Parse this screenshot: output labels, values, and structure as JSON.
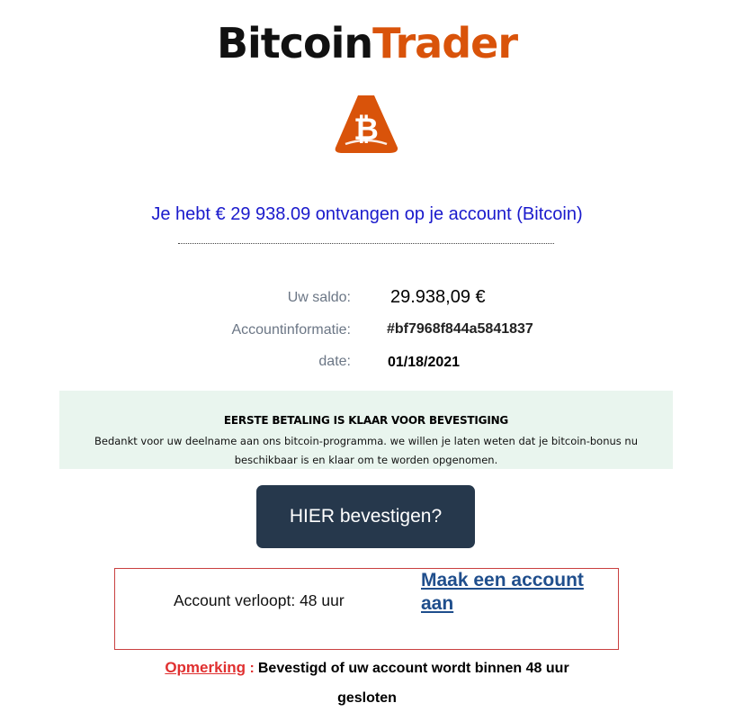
{
  "brand": {
    "part1": "Bitcoin",
    "part2": "Trader"
  },
  "logo": {
    "icon": "bitcoin-icon",
    "color": "#d9530a"
  },
  "headline": "Je hebt € 29 938.09 ontvangen op je account (Bitcoin)",
  "details": {
    "balance_label": "Uw saldo:",
    "balance_value": "29.938,09 €",
    "account_label": "Accountinformatie:",
    "account_value": "#bf7968f844a5841837",
    "date_label": "date:",
    "date_value": "01/18/2021"
  },
  "notice": {
    "title": "EERSTE BETALING IS KLAAR VOOR BEVESTIGING",
    "body": "Bedankt voor uw deelname aan ons bitcoin-programma. we willen je laten weten dat je bitcoin-bonus nu beschikbaar is en klaar om te worden opgenomen."
  },
  "cta_label": "HIER bevestigen?",
  "account_box": {
    "expiry": "Account verloopt: 48 uur",
    "create_link": "Maak een account aan"
  },
  "footer_note": {
    "label": "Opmerking",
    "colon": ":",
    "text_line1": "Bevestigd of uw account wordt binnen 48 uur",
    "text_line2": "gesloten"
  },
  "colors": {
    "accent": "#d9530a",
    "headline": "#1a1acc",
    "button": "#26384c",
    "warning": "#e03030"
  }
}
